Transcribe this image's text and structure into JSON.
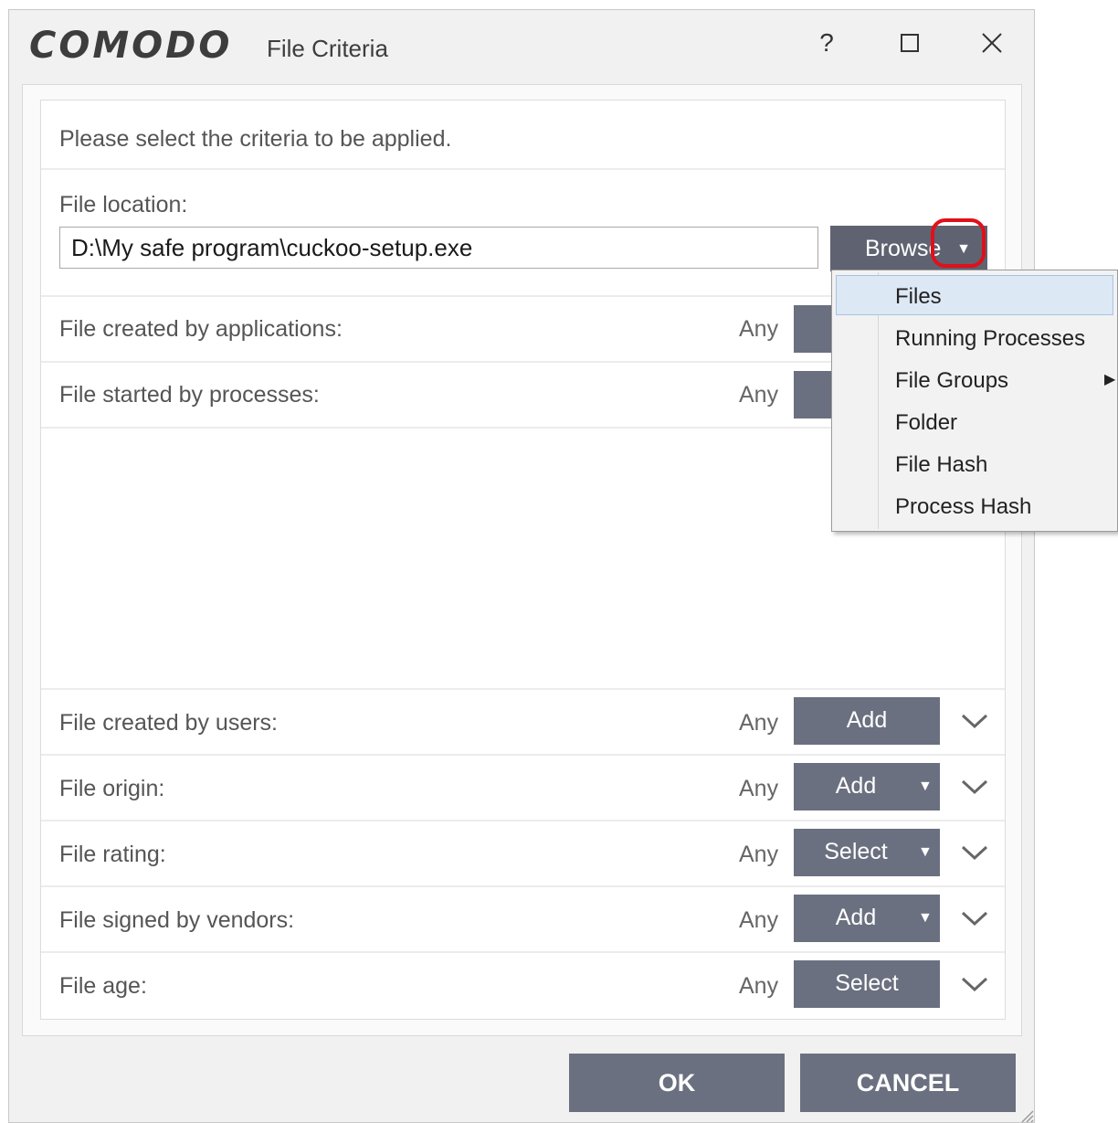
{
  "window": {
    "logo": "COMODO",
    "title": "File Criteria",
    "help_label": "?",
    "maximize_label": "☐",
    "close_label": "✕"
  },
  "instruction": "Please select the criteria to be applied.",
  "file_location": {
    "label": "File location:",
    "value": "D:\\My safe program\\cuckoo-setup.exe",
    "browse_label": "Browse"
  },
  "criteria": [
    {
      "label": "File created by applications:",
      "value": "Any"
    },
    {
      "label": "File started by processes:",
      "value": "Any"
    },
    {
      "label": "File created by users:",
      "value": "Any",
      "button": "Add"
    },
    {
      "label": "File origin:",
      "value": "Any",
      "button": "Add"
    },
    {
      "label": "File rating:",
      "value": "Any",
      "button": "Select"
    },
    {
      "label": "File signed by vendors:",
      "value": "Any",
      "button": "Add"
    },
    {
      "label": "File age:",
      "value": "Any",
      "button": "Select"
    }
  ],
  "browse_menu": {
    "items": [
      "Files",
      "Running Processes",
      "File Groups",
      "Folder",
      "File Hash",
      "Process Hash"
    ],
    "selected": "Files"
  },
  "footer": {
    "ok_label": "OK",
    "cancel_label": "CANCEL"
  },
  "colors": {
    "button_bg": "#6b7080",
    "highlight_ring": "#e0101a",
    "menu_selected": "#dde8f5"
  }
}
